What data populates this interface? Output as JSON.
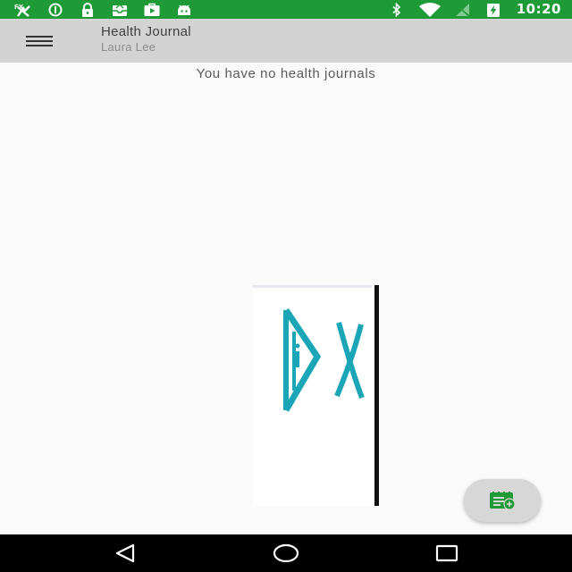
{
  "status_bar": {
    "time": "10:20",
    "left_icons": [
      "no-fire-icon",
      "data-saver-icon",
      "lock-icon",
      "inbox-icon",
      "play-store-icon",
      "android-icon"
    ],
    "right_icons": [
      "bluetooth-icon",
      "wifi-icon",
      "signal-off-icon",
      "battery-charging-icon"
    ],
    "background": "#1e9a37"
  },
  "app_bar": {
    "title": "Health Journal",
    "subtitle": "Laura Lee",
    "background": "#d3d3d3"
  },
  "content": {
    "empty_message": "You have no health journals",
    "image": "dx-logo-image"
  },
  "fab": {
    "icon": "add-journal-icon",
    "icon_color": "#1e9a37"
  },
  "nav_bar": {
    "buttons": [
      "back-icon",
      "home-icon",
      "recents-icon"
    ]
  }
}
